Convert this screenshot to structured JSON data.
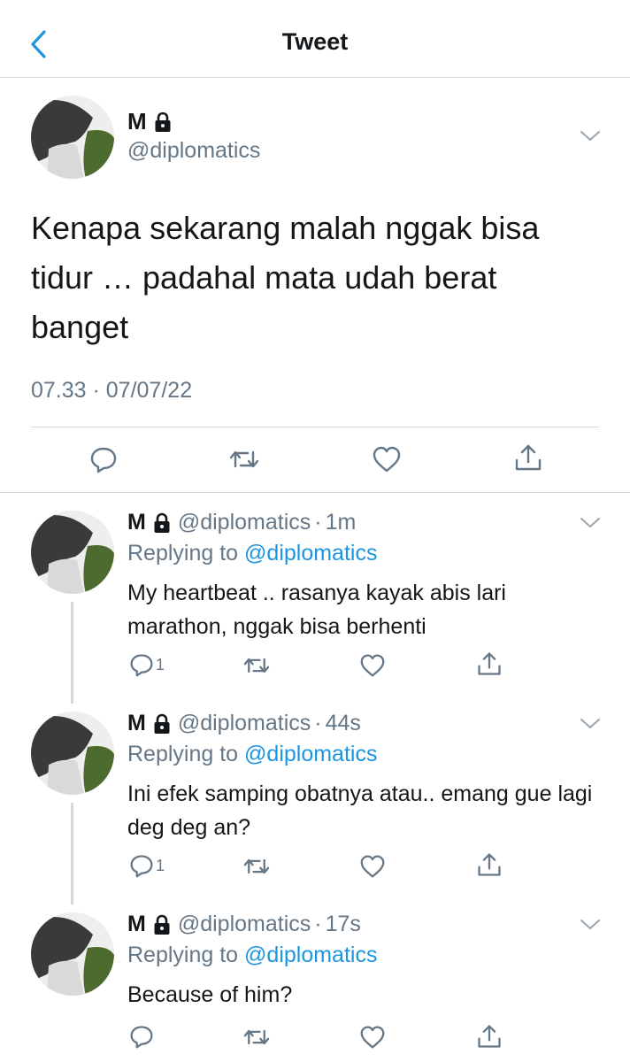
{
  "header": {
    "title": "Tweet",
    "back_icon": "chevron-left-icon",
    "accent": "#1b95e0"
  },
  "main_tweet": {
    "name": "M",
    "handle": "@diplomatics",
    "text": "Kenapa sekarang malah nggak bisa tidur … padahal mata udah berat banget",
    "timestamp": "07.33 · 07/07/22",
    "actions": [
      "comment-icon",
      "retweet-icon",
      "like-icon",
      "share-icon"
    ]
  },
  "replies": [
    {
      "name": "M",
      "handle": "@diplomatics",
      "dot": "·",
      "time": "1m",
      "replying_prefix": "Replying to",
      "replying_handle": "@diplomatics",
      "text": "My heartbeat .. rasanya kayak abis lari marathon, nggak bisa berhenti",
      "reply_count": "1"
    },
    {
      "name": "M",
      "handle": "@diplomatics",
      "dot": "·",
      "time": "44s",
      "replying_prefix": "Replying to",
      "replying_handle": "@diplomatics",
      "text": "Ini efek samping obatnya atau.. emang gue lagi deg deg an?",
      "reply_count": "1"
    },
    {
      "name": "M",
      "handle": "@diplomatics",
      "dot": "·",
      "time": "17s",
      "replying_prefix": "Replying to",
      "replying_handle": "@diplomatics",
      "text": "Because of him?",
      "reply_count": ""
    }
  ],
  "colors": {
    "text": "#14171a",
    "secondary": "#657786",
    "link": "#1b95e0",
    "divider": "#d6d9dc"
  }
}
